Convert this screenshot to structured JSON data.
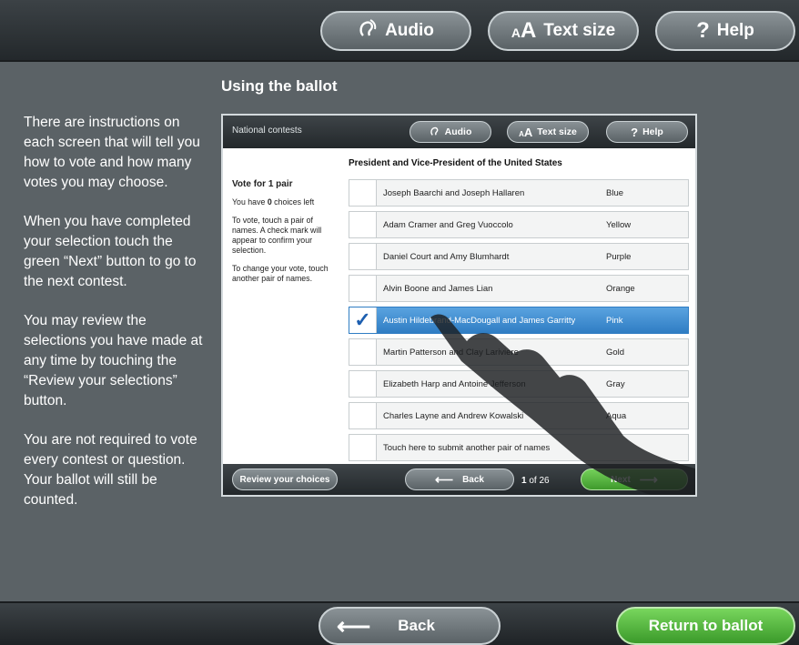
{
  "topbar": {
    "audio": {
      "label": "Audio",
      "icon": "audio-icon"
    },
    "text_size": {
      "label": "Text size",
      "glyph": "AA"
    },
    "help": {
      "label": "Help",
      "glyph": "?"
    }
  },
  "section_title": "Using the ballot",
  "instructions": [
    "There are instructions on each screen that will tell you how to vote and how many votes you may choose.",
    "When you have completed your selection touch the green “Next” button to go to the next contest.",
    "You may review the selections you have made at any time by touching the “Review your selections” button.",
    "You are not required to vote every contest or question.  Your ballot will still be counted."
  ],
  "screen": {
    "header_label": "National contests",
    "audio_label": "Audio",
    "text_size_label": "Text size",
    "help_label": "Help",
    "contest_title": "President and Vice-President of the United States",
    "vote_for": "Vote for 1 pair",
    "choices_prefix": "You have ",
    "choices_count": "0",
    "choices_suffix": " choices left",
    "touch_help": "To vote, touch a pair of names. A check mark will appear to confirm your selection.",
    "change_help": "To change your vote, touch another pair of names.",
    "candidates": [
      {
        "name": "Joseph Baarchi and Joseph Hallaren",
        "party": "Blue"
      },
      {
        "name": "Adam Cramer and Greg Vuoccolo",
        "party": "Yellow"
      },
      {
        "name": "Daniel Court and Amy Blumhardt",
        "party": "Purple"
      },
      {
        "name": "Alvin Boone and James Lian",
        "party": "Orange"
      },
      {
        "name": "Austin Hildebrand-MacDougall and James Garritty",
        "party": "Pink",
        "selected": true
      },
      {
        "name": "Martin Patterson and Clay Lariviere",
        "party": "Gold"
      },
      {
        "name": "Elizabeth Harp and Antoine Jefferson",
        "party": "Gray"
      },
      {
        "name": "Charles Layne and Andrew Kowalski",
        "party": "Aqua"
      },
      {
        "name": "Touch here to submit another pair of names",
        "party": ""
      }
    ],
    "review_label": "Review your choices",
    "back_label": "Back",
    "page_current": "1",
    "page_total": "of 26",
    "next_label": "Next"
  },
  "bottombar": {
    "back_label": "Back",
    "return_label": "Return to ballot"
  },
  "colors": {
    "background": "#5b6266",
    "selected_row": "#3b88cc",
    "next_green": "#4fae38"
  }
}
